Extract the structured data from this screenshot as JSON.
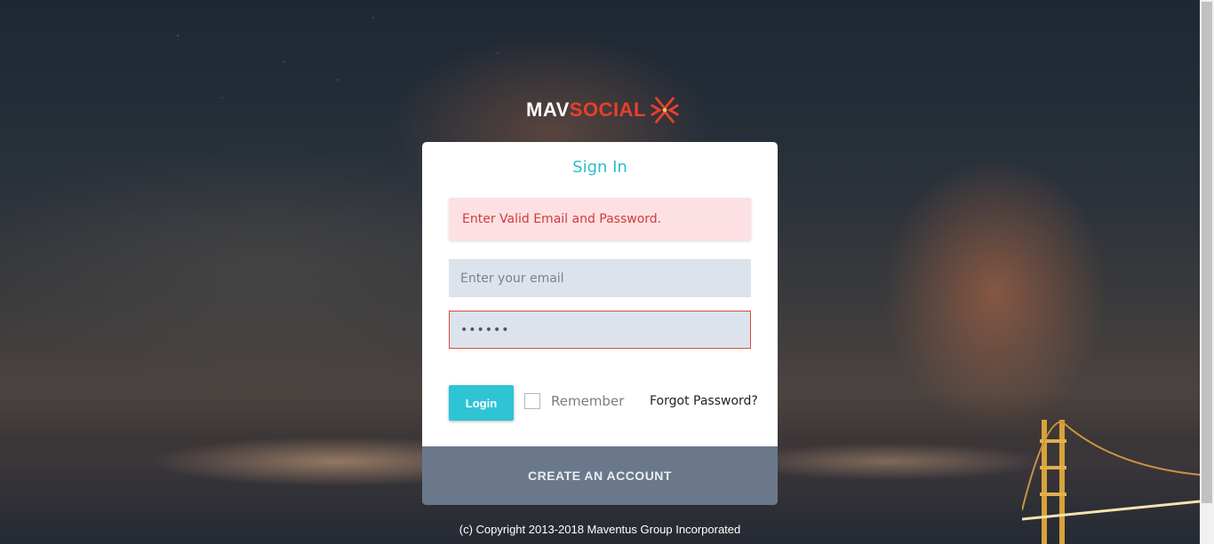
{
  "brand": {
    "name_part1": "MAV",
    "name_part2": "SOCIAL",
    "accent_color": "#e8402a",
    "icon": "maventus-cross-icon"
  },
  "signin": {
    "title": "Sign In",
    "error_message": "Enter Valid Email and Password.",
    "email": {
      "value": "",
      "placeholder": "Enter your email"
    },
    "password": {
      "value": "••••••",
      "placeholder": ""
    },
    "login_label": "Login",
    "remember_label": "Remember",
    "remember_checked": false,
    "forgot_label": "Forgot Password?",
    "create_account_label": "CREATE AN ACCOUNT",
    "title_color": "#2bbdd0",
    "button_color": "#2ec4d4",
    "error_color": "#d33a3a"
  },
  "footer": {
    "copyright": "(c) Copyright 2013-2018 Maventus Group Incorporated"
  }
}
